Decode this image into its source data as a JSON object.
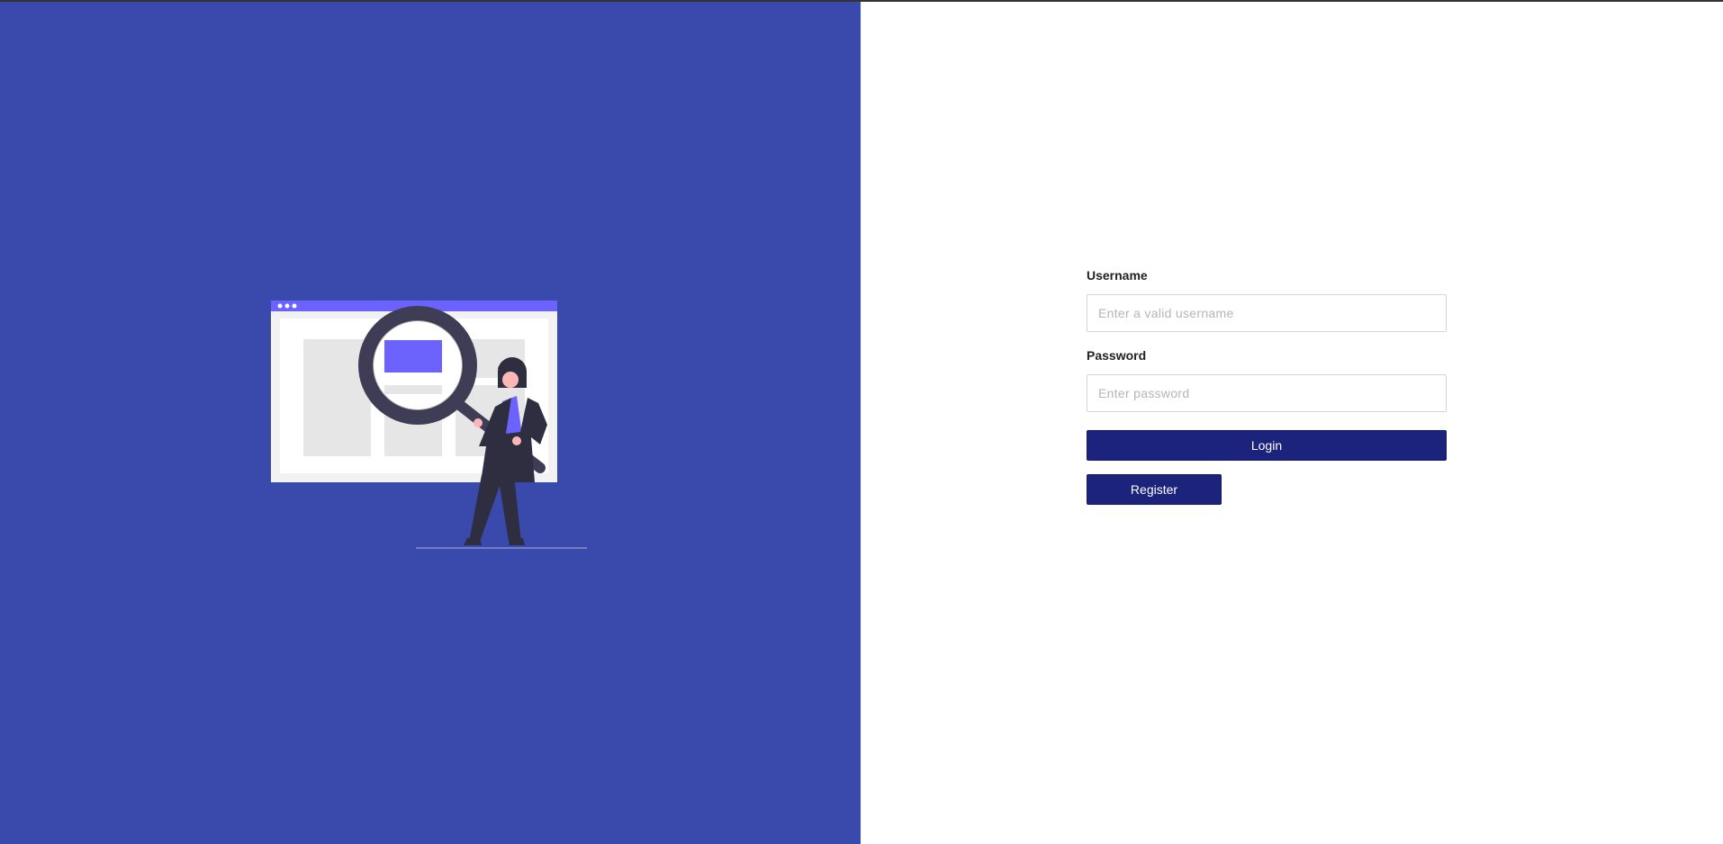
{
  "login_form": {
    "username_label": "Username",
    "username_placeholder": "Enter a valid username",
    "username_value": "",
    "password_label": "Password",
    "password_placeholder": "Enter password",
    "password_value": "",
    "login_label": "Login",
    "register_label": "Register"
  },
  "colors": {
    "left_panel_background": "#3a4aac",
    "button_background": "#1b237c",
    "illustration_accent": "#6c63ff",
    "illustration_dark": "#2f2e41"
  },
  "illustration": {
    "icon": "person-with-magnifying-glass-illustration"
  }
}
